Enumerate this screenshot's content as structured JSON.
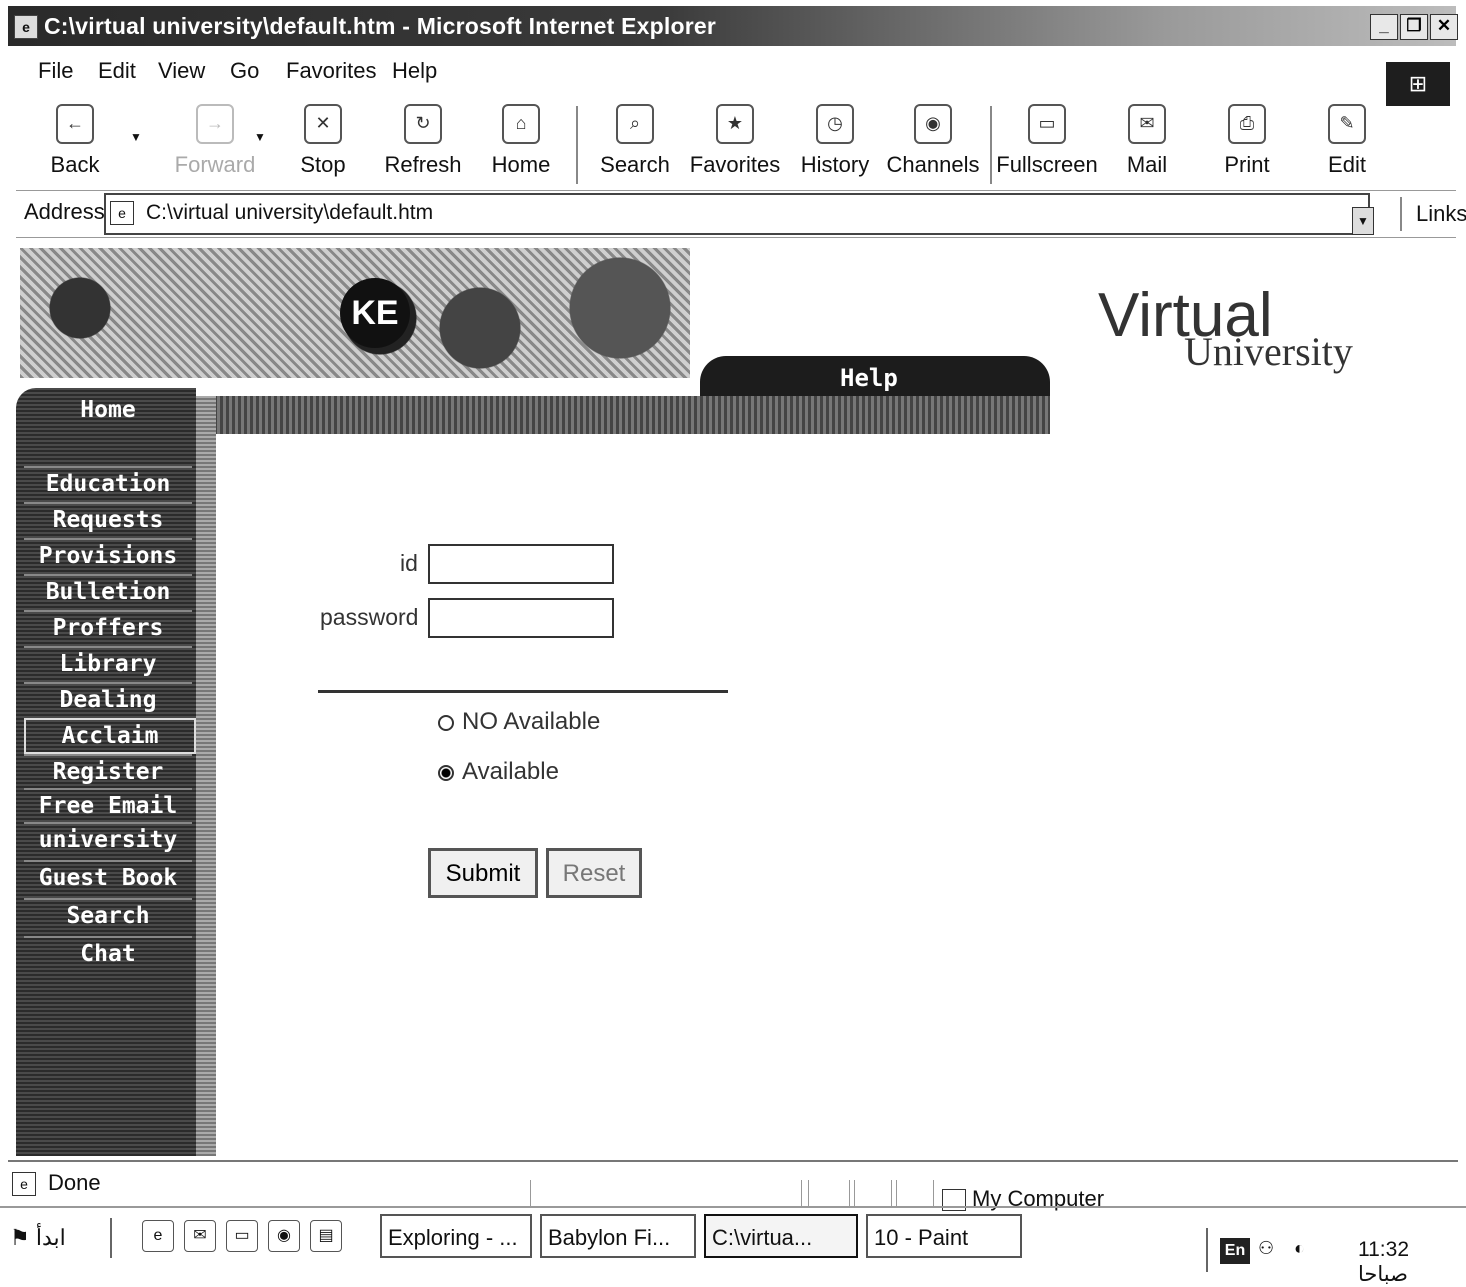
{
  "window": {
    "title": "C:\\virtual university\\default.htm - Microsoft Internet Explorer",
    "controls": [
      "_",
      "❐",
      "✕"
    ]
  },
  "menu": [
    "File",
    "Edit",
    "View",
    "Go",
    "Favorites",
    "Help"
  ],
  "toolbar": {
    "back": "Back",
    "forward": "Forward",
    "stop": "Stop",
    "refresh": "Refresh",
    "home": "Home",
    "search": "Search",
    "favorites": "Favorites",
    "history": "History",
    "channels": "Channels",
    "fullscreen": "Fullscreen",
    "mail": "Mail",
    "print": "Print",
    "edit": "Edit"
  },
  "address": {
    "label": "Address",
    "url": "C:\\virtual university\\default.htm",
    "links": "Links"
  },
  "page": {
    "site_title": "Virtual",
    "site_subtitle": "University",
    "help_tab": "Help",
    "nav": [
      "Home",
      "Education",
      "Requests",
      "Provisions",
      "Bulletion",
      "Proffers",
      "Library",
      "Dealing",
      "Acclaim",
      "Register",
      "Free Email",
      "university",
      "Guest Book",
      "Search",
      "Chat"
    ],
    "active_nav": "Acclaim",
    "form": {
      "id_label": "id",
      "id_value": "",
      "password_label": "password",
      "password_value": "",
      "radio_no": "NO Available",
      "radio_yes": "Available",
      "selected": "Available",
      "submit": "Submit",
      "reset": "Reset"
    }
  },
  "status": {
    "text": "Done",
    "zone": "My Computer"
  },
  "taskbar": {
    "start": "ابدأ",
    "tasks": [
      "Exploring - ...",
      "Babylon Fi...",
      "C:\\virtua...",
      "10 - Paint"
    ],
    "active_task": "C:\\virtua...",
    "tray": {
      "lang": "En",
      "clock": "11:32 صباحا"
    }
  }
}
